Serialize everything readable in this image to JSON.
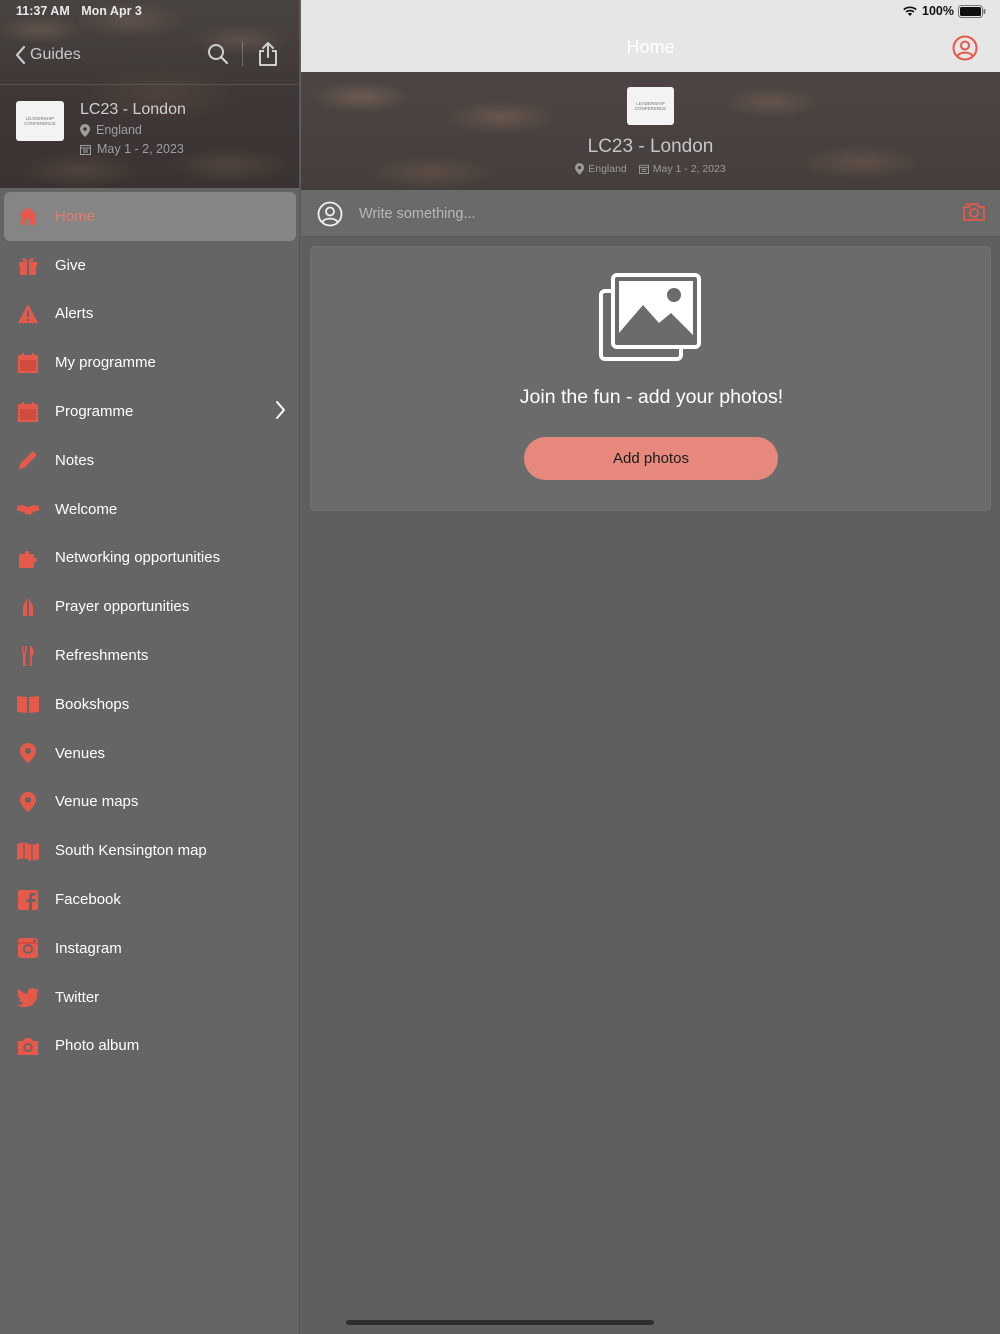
{
  "status_bar": {
    "time": "11:37 AM",
    "date": "Mon Apr 3",
    "battery": "100%"
  },
  "sidebar": {
    "back_label": "Guides",
    "guide": {
      "logo_text": "LEADERSHIP CONFERENCE",
      "title": "LC23 - London",
      "location": "England",
      "dates": "May 1 - 2, 2023"
    },
    "items": [
      {
        "label": "Home",
        "icon": "home-icon",
        "active": true
      },
      {
        "label": "Give",
        "icon": "gift-icon"
      },
      {
        "label": "Alerts",
        "icon": "alert-icon"
      },
      {
        "label": "My programme",
        "icon": "calendar-icon"
      },
      {
        "label": "Programme",
        "icon": "calendar-icon",
        "has_children": true
      },
      {
        "label": "Notes",
        "icon": "pencil-icon"
      },
      {
        "label": "Welcome",
        "icon": "handshake-icon"
      },
      {
        "label": "Networking opportunities",
        "icon": "puzzle-icon"
      },
      {
        "label": "Prayer opportunities",
        "icon": "praying-hands-icon"
      },
      {
        "label": "Refreshments",
        "icon": "fork-knife-icon"
      },
      {
        "label": "Bookshops",
        "icon": "book-icon"
      },
      {
        "label": "Venues",
        "icon": "map-pin-icon"
      },
      {
        "label": "Venue maps",
        "icon": "map-pin-icon"
      },
      {
        "label": "South Kensington map",
        "icon": "map-icon"
      },
      {
        "label": "Facebook",
        "icon": "facebook-icon"
      },
      {
        "label": "Instagram",
        "icon": "instagram-icon"
      },
      {
        "label": "Twitter",
        "icon": "twitter-icon"
      },
      {
        "label": "Photo album",
        "icon": "camera-icon"
      }
    ]
  },
  "header": {
    "title": "Home"
  },
  "banner": {
    "logo_text": "LEADERSHIP CONFERENCE",
    "title": "LC23 - London",
    "location": "England",
    "dates": "May 1 - 2, 2023"
  },
  "composer": {
    "placeholder": "Write something..."
  },
  "photos": {
    "prompt": "Join the fun - add your photos!",
    "button_label": "Add photos"
  },
  "colors": {
    "accent": "#e5594b",
    "button": "#e6897c",
    "sidebar_bg": "#656565",
    "main_bg": "#5f5f5f",
    "active_item_bg": "#858585"
  }
}
